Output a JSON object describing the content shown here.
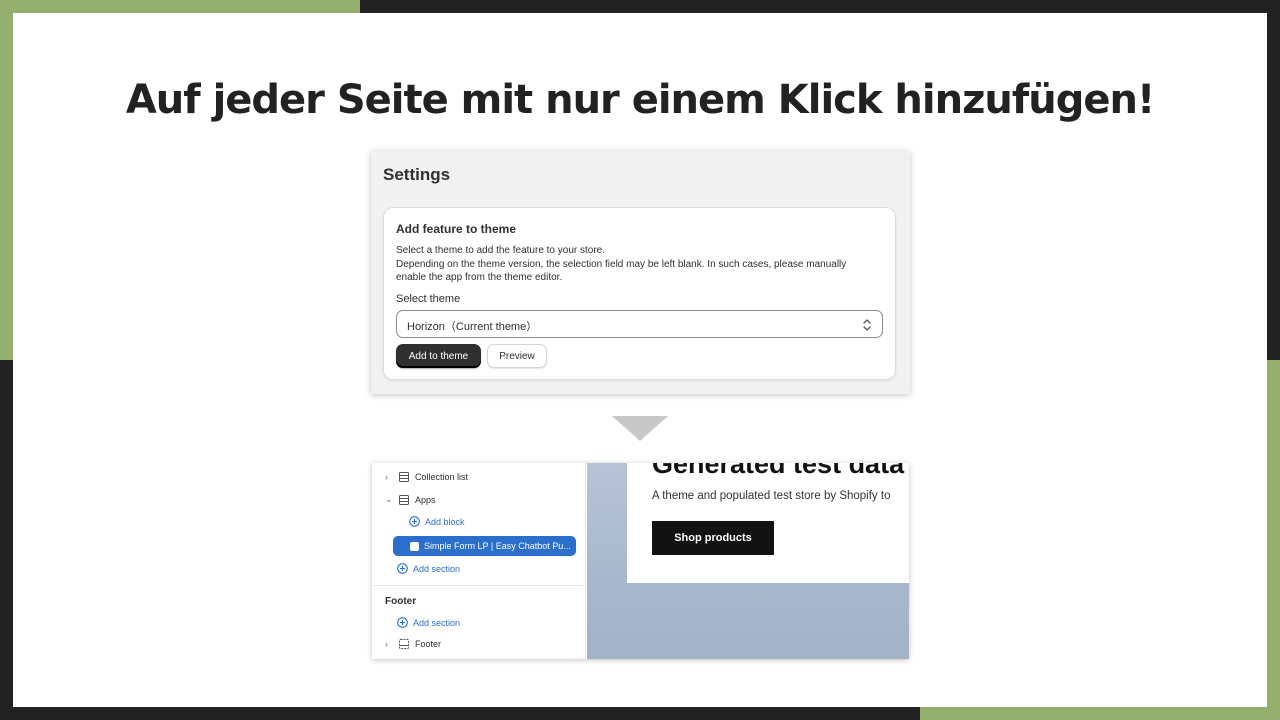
{
  "colors": {
    "accent_green": "#94ae6e",
    "frame_dark": "#222222",
    "link_blue": "#2c6ecb"
  },
  "headline": "Auf jeder Seite mit nur einem Klick hinzufügen!",
  "settings": {
    "title": "Settings",
    "card_title": "Add feature to theme",
    "description": [
      "Select a theme to add the feature to your store.",
      "Depending on the theme version, the selection field may be left blank. In such cases, please manually",
      "enable the app from the theme editor."
    ],
    "select_label": "Select theme",
    "selected_theme": "Horizon（Current theme）",
    "add_button": "Add to theme",
    "preview_button": "Preview"
  },
  "editor": {
    "sidebar": {
      "collection_list": "Collection list",
      "apps": "Apps",
      "add_block": "Add block",
      "selected_app": "Simple Form LP | Easy Chatbot Pu...",
      "add_section_1": "Add section",
      "footer_heading": "Footer",
      "add_section_2": "Add section",
      "footer_item": "Footer"
    },
    "preview": {
      "hero_title": "Generated test data",
      "hero_subtitle": "A theme and populated test store by Shopify to",
      "shop_button": "Shop products"
    }
  }
}
